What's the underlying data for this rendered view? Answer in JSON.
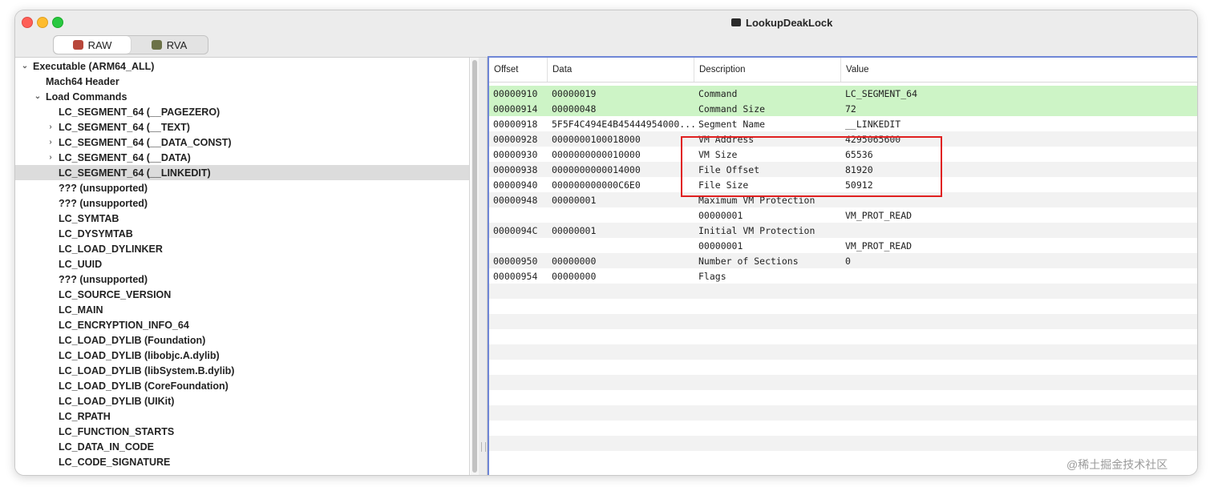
{
  "window": {
    "title": "LookupDeakLock"
  },
  "segmented": {
    "raw_label": "RAW",
    "rva_label": "RVA",
    "selected": "RAW"
  },
  "tree": {
    "items": [
      {
        "label": "Executable  (ARM64_ALL)",
        "indent": 0,
        "arrow": "v"
      },
      {
        "label": "Mach64 Header",
        "indent": 1,
        "arrow": ""
      },
      {
        "label": "Load Commands",
        "indent": 1,
        "arrow": "v"
      },
      {
        "label": "LC_SEGMENT_64 (__PAGEZERO)",
        "indent": 2,
        "arrow": ""
      },
      {
        "label": "LC_SEGMENT_64 (__TEXT)",
        "indent": 2,
        "arrow": ">"
      },
      {
        "label": "LC_SEGMENT_64 (__DATA_CONST)",
        "indent": 2,
        "arrow": ">"
      },
      {
        "label": "LC_SEGMENT_64 (__DATA)",
        "indent": 2,
        "arrow": ">"
      },
      {
        "label": "LC_SEGMENT_64 (__LINKEDIT)",
        "indent": 2,
        "arrow": "",
        "selected": true
      },
      {
        "label": "??? (unsupported)",
        "indent": 2,
        "arrow": ""
      },
      {
        "label": "??? (unsupported)",
        "indent": 2,
        "arrow": ""
      },
      {
        "label": "LC_SYMTAB",
        "indent": 2,
        "arrow": ""
      },
      {
        "label": "LC_DYSYMTAB",
        "indent": 2,
        "arrow": ""
      },
      {
        "label": "LC_LOAD_DYLINKER",
        "indent": 2,
        "arrow": ""
      },
      {
        "label": "LC_UUID",
        "indent": 2,
        "arrow": ""
      },
      {
        "label": "??? (unsupported)",
        "indent": 2,
        "arrow": ""
      },
      {
        "label": "LC_SOURCE_VERSION",
        "indent": 2,
        "arrow": ""
      },
      {
        "label": "LC_MAIN",
        "indent": 2,
        "arrow": ""
      },
      {
        "label": "LC_ENCRYPTION_INFO_64",
        "indent": 2,
        "arrow": ""
      },
      {
        "label": "LC_LOAD_DYLIB (Foundation)",
        "indent": 2,
        "arrow": ""
      },
      {
        "label": "LC_LOAD_DYLIB (libobjc.A.dylib)",
        "indent": 2,
        "arrow": ""
      },
      {
        "label": "LC_LOAD_DYLIB (libSystem.B.dylib)",
        "indent": 2,
        "arrow": ""
      },
      {
        "label": "LC_LOAD_DYLIB (CoreFoundation)",
        "indent": 2,
        "arrow": ""
      },
      {
        "label": "LC_LOAD_DYLIB (UIKit)",
        "indent": 2,
        "arrow": ""
      },
      {
        "label": "LC_RPATH",
        "indent": 2,
        "arrow": ""
      },
      {
        "label": "LC_FUNCTION_STARTS",
        "indent": 2,
        "arrow": ""
      },
      {
        "label": "LC_DATA_IN_CODE",
        "indent": 2,
        "arrow": ""
      },
      {
        "label": "LC_CODE_SIGNATURE",
        "indent": 2,
        "arrow": ""
      }
    ]
  },
  "table": {
    "headers": [
      "Offset",
      "Data",
      "Description",
      "Value"
    ],
    "rows": [
      {
        "offset": "00000910",
        "data": "00000019",
        "description": "Command",
        "value": "LC_SEGMENT_64",
        "style": "green"
      },
      {
        "offset": "00000914",
        "data": "00000048",
        "description": "Command Size",
        "value": "72",
        "style": "green"
      },
      {
        "offset": "00000918",
        "data": "5F5F4C494E4B45444954000...",
        "description": "Segment Name",
        "value": "__LINKEDIT",
        "style": "odd"
      },
      {
        "offset": "00000928",
        "data": "0000000100018000",
        "description": "VM Address",
        "value": "4295065600",
        "style": "even"
      },
      {
        "offset": "00000930",
        "data": "0000000000010000",
        "description": "VM Size",
        "value": "65536",
        "style": "odd"
      },
      {
        "offset": "00000938",
        "data": "0000000000014000",
        "description": "File Offset",
        "value": "81920",
        "style": "even"
      },
      {
        "offset": "00000940",
        "data": "000000000000C6E0",
        "description": "File Size",
        "value": "50912",
        "style": "odd"
      },
      {
        "offset": "00000948",
        "data": "00000001",
        "description": "Maximum VM Protection",
        "value": "",
        "style": "even"
      },
      {
        "offset": "",
        "data": "",
        "description": "00000001",
        "value": "VM_PROT_READ",
        "style": "odd"
      },
      {
        "offset": "0000094C",
        "data": "00000001",
        "description": "Initial VM Protection",
        "value": "",
        "style": "even"
      },
      {
        "offset": "",
        "data": "",
        "description": "00000001",
        "value": "VM_PROT_READ",
        "style": "odd"
      },
      {
        "offset": "00000950",
        "data": "00000000",
        "description": "Number of Sections",
        "value": "0",
        "style": "even"
      },
      {
        "offset": "00000954",
        "data": "00000000",
        "description": "Flags",
        "value": "",
        "style": "odd"
      }
    ]
  },
  "watermark": "@稀土掘金技术社区"
}
